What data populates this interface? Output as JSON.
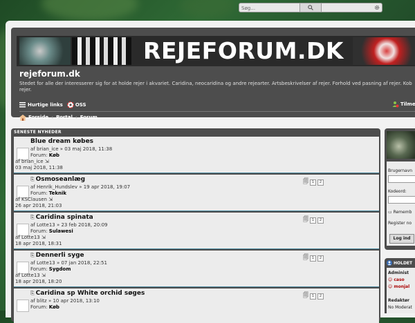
{
  "search": {
    "placeholder": "Søg…"
  },
  "header": {
    "banner_title": "REJEFORUM.DK",
    "site_name": "rejeforum.dk",
    "site_description": "Stedet for alle der interesserer sig for at holde rejer i akvariet. Caridina, neocaridina og andre rejearter. Artsbeskrivelser af rejer. Forhold ved pasning af rejer. Kob rejer."
  },
  "nav": {
    "quick_links": "Hurtige links",
    "faq": "OSS",
    "register": "Tilmeld",
    "breadcrumbs": [
      "Forside",
      "Portal",
      "Forum"
    ]
  },
  "news": {
    "heading": "SENESTE NYHEDER",
    "topics": [
      {
        "title": "Blue dream købes",
        "byline": "af brian_ice » 03 maj 2018, 11:38",
        "forum_label": "Forum:",
        "forum": "Køb",
        "last_by": "af brian_ice",
        "last_time": "03 maj 2018, 11:38",
        "pages": []
      },
      {
        "title": "Osmoseanlæg",
        "byline": "af Henrik_Hundslev » 19 apr 2018, 19:07",
        "forum_label": "Forum:",
        "forum": "Teknik",
        "last_by": "af KSClausen",
        "last_time": "26 apr 2018, 21:03",
        "pages": [
          "1",
          "2"
        ]
      },
      {
        "title": "Caridina spinata",
        "byline": "af Lotte13 » 23 feb 2018, 20:09",
        "forum_label": "Forum:",
        "forum": "Sulawesi",
        "last_by": "af Lotte13",
        "last_time": "18 apr 2018, 18:31",
        "pages": [
          "1",
          "2"
        ]
      },
      {
        "title": "Dennerli syge",
        "byline": "af Lotte13 » 07 jan 2018, 22:51",
        "forum_label": "Forum:",
        "forum": "Sygdom",
        "last_by": "af Lotte13",
        "last_time": "18 apr 2018, 18:20",
        "pages": [
          "1",
          "2"
        ]
      },
      {
        "title": "Caridina sp White orchid søges",
        "byline": "af blitz » 10 apr 2018, 13:10",
        "forum_label": "Forum:",
        "forum": "Køb",
        "last_by": "",
        "last_time": "",
        "pages": [
          "1",
          "2"
        ]
      }
    ]
  },
  "login": {
    "username_label": "Brugernavn",
    "password_label": "Kodeord:",
    "remember_label": "Rememb",
    "register_label": "Register no",
    "login_button": "Log ind"
  },
  "online": {
    "heading": "HOLDET",
    "admins_label": "Administ",
    "admin1": "caso",
    "admin2": "monjal",
    "editors_label": "Redaktør",
    "editors_value": "No Moderat"
  },
  "colors": {
    "accent": "#4a8aa0",
    "panel": "#4d4d4d",
    "admin_red": "#aa0000"
  }
}
